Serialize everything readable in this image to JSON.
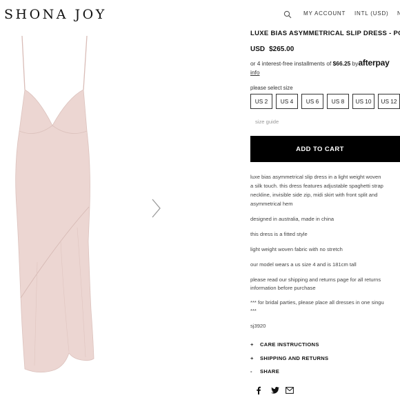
{
  "header": {
    "logo": "SHONA JOY",
    "nav": [
      "MY ACCOUNT",
      "INTL (USD)",
      "N"
    ]
  },
  "product": {
    "title": "LUXE BIAS ASYMMETRICAL SLIP DRESS - POI",
    "currency": "USD",
    "price": "$265.00",
    "afterpay": {
      "prefix": "or 4 interest-free installments of",
      "amount": "$66.25",
      "by": "by",
      "brand": "afterpay",
      "info": "info"
    },
    "size_label": "please select size",
    "sizes": [
      "US 2",
      "US 4",
      "US 6",
      "US 8",
      "US 10",
      "US 12"
    ],
    "size_guide": "size guide",
    "add_to_cart": "ADD TO CART",
    "description": [
      "luxe bias asymmetrical slip dress in a light weight woven",
      "a silk touch. this dress features adjustable spaghetti strap",
      "neckline, invisible side zip, midi skirt with front split and",
      "asymmetrical hem",
      "designed in australia, made in china",
      "this dress is a fitted style",
      "light weight woven fabric with no stretch",
      "our model wears a us size 4 and is 181cm tall",
      "please read our shipping and returns page for all returns",
      "information before purchase",
      "*** for bridal parties, please place all dresses in one singu",
      "***",
      "sj3920"
    ],
    "accordions": [
      {
        "symbol": "+",
        "label": "CARE INSTRUCTIONS"
      },
      {
        "symbol": "+",
        "label": "SHIPPING AND RETURNS"
      },
      {
        "symbol": "-",
        "label": "SHARE"
      }
    ],
    "share_icons": [
      "facebook-icon",
      "twitter-icon",
      "mail-icon"
    ]
  },
  "colors": {
    "dress": "#ecd6d2",
    "button": "#000000"
  }
}
